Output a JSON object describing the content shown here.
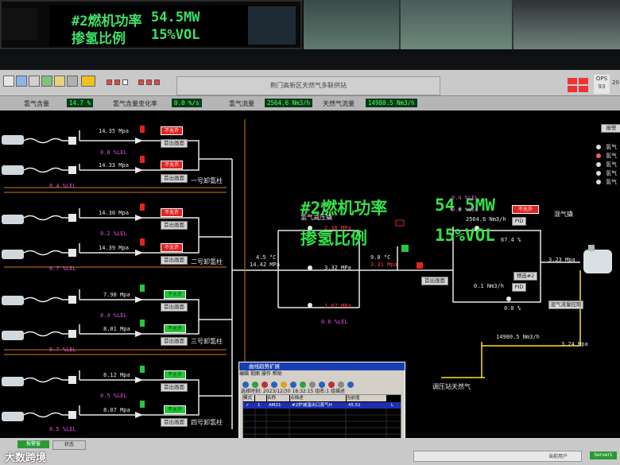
{
  "top_monitor": {
    "power_label": "#2燃机功率",
    "power_value": "54.5MW",
    "ratio_label": "掺氢比例",
    "ratio_value": "15%VOL"
  },
  "header": {
    "title": "荆门高新区天然气多联供站",
    "ops_label": "OPS",
    "ops_value": "93",
    "right_corner": "20"
  },
  "infobar": {
    "h2_content_label": "氢气含量",
    "h2_content_value": "14.7 %",
    "h2_change_label": "氢气含量变化率",
    "h2_change_value": "0.0 %/s",
    "h2_flow_label": "氢气流量",
    "h2_flow_value": "2564.6 Nm3/h",
    "ng_flow_label": "天然气流量",
    "ng_flow_value": "14980.5 Nm3/h"
  },
  "main": {
    "power_label": "#2燃机功率",
    "power_value": "54.5MW",
    "ratio_label": "掺氢比例",
    "ratio_value": "15%VOL"
  },
  "stations": [
    {
      "name": "一号卸氢柱",
      "p1": "14.35 Mpa",
      "p2": "14.33 Mpa",
      "lel1": "0.8 %LEL",
      "lel2": "0.4 %LEL",
      "state1": "不允许",
      "state2": "不允许",
      "btn": "首出画面"
    },
    {
      "name": "二号卸氢柱",
      "p1": "14.30 Mpa",
      "p2": "14.39 Mpa",
      "lel1": "0.2 %LEL",
      "lel2": "0.7 %LEL",
      "state1": "不允许",
      "state2": "不允许",
      "btn": "首出画面"
    },
    {
      "name": "三号卸氢柱",
      "p1": "7.98 Mpa",
      "p2": "8.01 Mpa",
      "lel1": "0.4 %LEL",
      "lel2": "0.7 %LEL",
      "state1": "不允许",
      "state2": "不允许",
      "btn": "首出画面"
    },
    {
      "name": "四号卸氢柱",
      "p1": "8.12 Mpa",
      "p2": "8.07 Mpa",
      "lel1": "0.5 %LEL",
      "lel2": "0.5 %LEL",
      "state1": "不允许",
      "state2": "不允许",
      "btn": "首出画面"
    }
  ],
  "pressure_skid": {
    "title": "氢气减压撬",
    "inlet_temp": "4.5 °C",
    "inlet_press": "14.42 MPa",
    "p_top": "2.38 MPa",
    "p_mid": "3.32 MPa",
    "p_bot": "1.07 MPa",
    "lel": "0.6 %LEL",
    "out_temp": "9.0 °C",
    "out_press": "3.31 Mpa",
    "btn": "首出画面"
  },
  "mixing": {
    "title": "混气撬",
    "lel1": "0.4 %LEL",
    "lel2": "0.6 %LEL",
    "flow": "2564.6 Nm3/h",
    "status_btn": "不允许",
    "pid": "PID",
    "pct": "67.4 %",
    "flow2": "0.1 Nm3/h",
    "pct2": "0.0 %",
    "preset": "预选#2",
    "ctrl_btn": "混气流量控制",
    "out_press": "3.23 Mpa"
  },
  "gas_station": {
    "label": "调压站天然气",
    "flow": "14980.5 Nm3/h",
    "press": "3.24 Mpa"
  },
  "legend": {
    "btn": "报警",
    "items": [
      "氢气",
      "氢气",
      "氢气",
      "氢气",
      "氢气"
    ]
  },
  "trend_window": {
    "title": "曲线趋势扩展",
    "menu": "编辑  视图  操作  帮助",
    "info": "选择时刻: 2023/12/30 18:32:15  组名:1  组描述",
    "col_mode": "模式",
    "col_name": "名称",
    "col_desc": "点描述",
    "col_value": "当前值",
    "row_no": "1",
    "row_name": "AM21",
    "row_desc": "#2炉减温出口蒸气H",
    "row_value": "45.51",
    "row_flag": "L"
  },
  "statusbar": {
    "btn1": "报警窗",
    "btn2": "状态",
    "server": "Server1",
    "footer": "当前用户"
  },
  "watermark": "大数跨境"
}
